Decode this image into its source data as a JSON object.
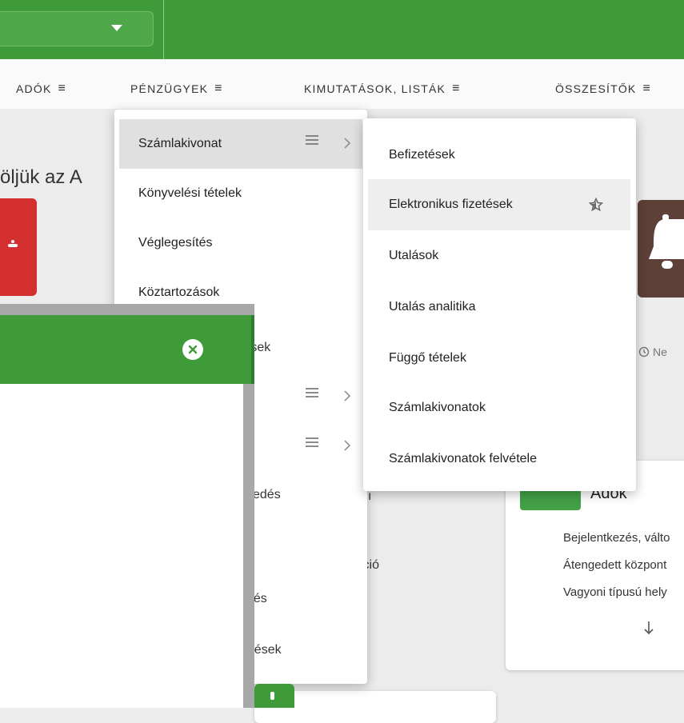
{
  "topbar": {
    "select_value": ""
  },
  "menubar": {
    "items": [
      {
        "label": "ADÓK"
      },
      {
        "label": "PÉNZÜGYEK"
      },
      {
        "label": "KIMUTATÁSOK, LISTÁK"
      },
      {
        "label": "ÖSSZESÍTŐK"
      }
    ],
    "menu_glyph": "≡"
  },
  "page": {
    "headline_partial": "öljük az A"
  },
  "menu_level1": {
    "items": [
      {
        "label": "Számlakivonat",
        "has_submenu": true,
        "active": true
      },
      {
        "label": "Könyvelési tételek"
      },
      {
        "label": "Véglegesítés"
      },
      {
        "label": "Köztartozások"
      }
    ]
  },
  "menu_level2": {
    "items": [
      {
        "label": "Befizetések"
      },
      {
        "label": "Elektronikus fizetések",
        "active": true,
        "favorite_icon": "star-icon"
      },
      {
        "label": "Utalások"
      },
      {
        "label": "Utalás analitika"
      },
      {
        "label": "Függő tételek"
      },
      {
        "label": "Számlakivonatok"
      },
      {
        "label": "Számlakivonatok felvétele"
      }
    ]
  },
  "partial_texts": {
    "p1": "tések",
    "p2": "zkedés",
    "p3": "rmáció",
    "p4": "ejtés",
    "p5": "edések",
    "p6": "ı"
  },
  "history": {
    "label": "Ne"
  },
  "card_right": {
    "title": "Adók",
    "lines": [
      "Bejelentkezés, válto",
      "Átengedett központ",
      "Vagyoni típusú hely"
    ]
  },
  "colors": {
    "primary_green": "#3f9a3a",
    "danger_red": "#d32f2f",
    "brown": "#5d4037"
  }
}
